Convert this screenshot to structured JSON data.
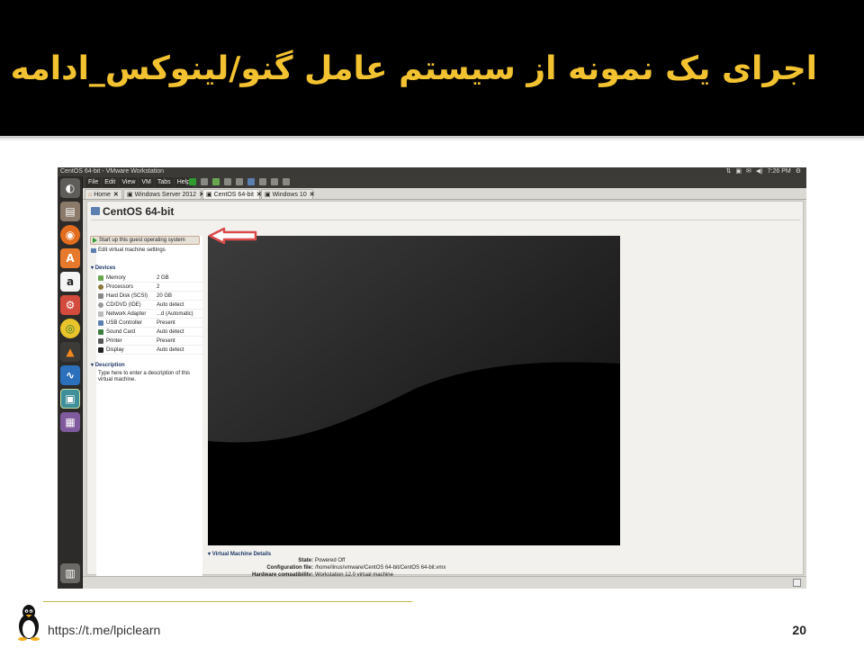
{
  "slide": {
    "title": "اجرای یک نمونه از سیستم عامل گنو/لینوکس_ادامه",
    "footer_url": "https://t.me/lpiclearn",
    "page_number": "20"
  },
  "desktop": {
    "window_title": "CentOS 64-bit - VMware Workstation",
    "clock": "7:26 PM",
    "launcher_items": [
      "dash-icon",
      "files-icon",
      "firefox-icon",
      "software-center-icon",
      "amazon-icon",
      "settings-icon",
      "chrome-icon",
      "vlc-icon",
      "system-monitor-icon",
      "vmware-icon",
      "workspace-icon",
      "trash-icon"
    ]
  },
  "vmware": {
    "menus": [
      "File",
      "Edit",
      "View",
      "VM",
      "Tabs",
      "Help"
    ],
    "tabs": [
      {
        "label": "Home"
      },
      {
        "label": "Windows Server 2012"
      },
      {
        "label": "CentOS 64-bit"
      },
      {
        "label": "Windows 10"
      }
    ],
    "vm_name": "CentOS 64-bit",
    "start_label": "Start up this guest operating system",
    "edit_label": "Edit virtual machine settings",
    "devices_header": "Devices",
    "devices": [
      {
        "name": "Memory",
        "value": "2 GB",
        "color": "#6aa84f"
      },
      {
        "name": "Processors",
        "value": "2",
        "color": "#8c7a3a"
      },
      {
        "name": "Hard Disk (SCSI)",
        "value": "20 GB",
        "color": "#888888"
      },
      {
        "name": "CD/DVD (IDE)",
        "value": "Auto detect",
        "color": "#999999"
      },
      {
        "name": "Network Adapter",
        "value": "...d (Automatic)",
        "color": "#bbbbbb"
      },
      {
        "name": "USB Controller",
        "value": "Present",
        "color": "#5b7fae"
      },
      {
        "name": "Sound Card",
        "value": "Auto detect",
        "color": "#3a7d3a"
      },
      {
        "name": "Printer",
        "value": "Present",
        "color": "#555555"
      },
      {
        "name": "Display",
        "value": "Auto detect",
        "color": "#222222"
      }
    ],
    "description_header": "Description",
    "description_text": "Type here to enter a description of this virtual machine.",
    "details_header": "Virtual Machine Details",
    "details": [
      {
        "key": "State:",
        "value": "Powered Off"
      },
      {
        "key": "Configuration file:",
        "value": "/home/linus/vmware/CentOS 64-bit/CentOS 64-bit.vmx"
      },
      {
        "key": "Hardware compatibility:",
        "value": "Workstation 12.0 virtual machine"
      }
    ]
  },
  "colors": {
    "title_gold": "#f2c230",
    "callout_red": "#d94b4b"
  }
}
